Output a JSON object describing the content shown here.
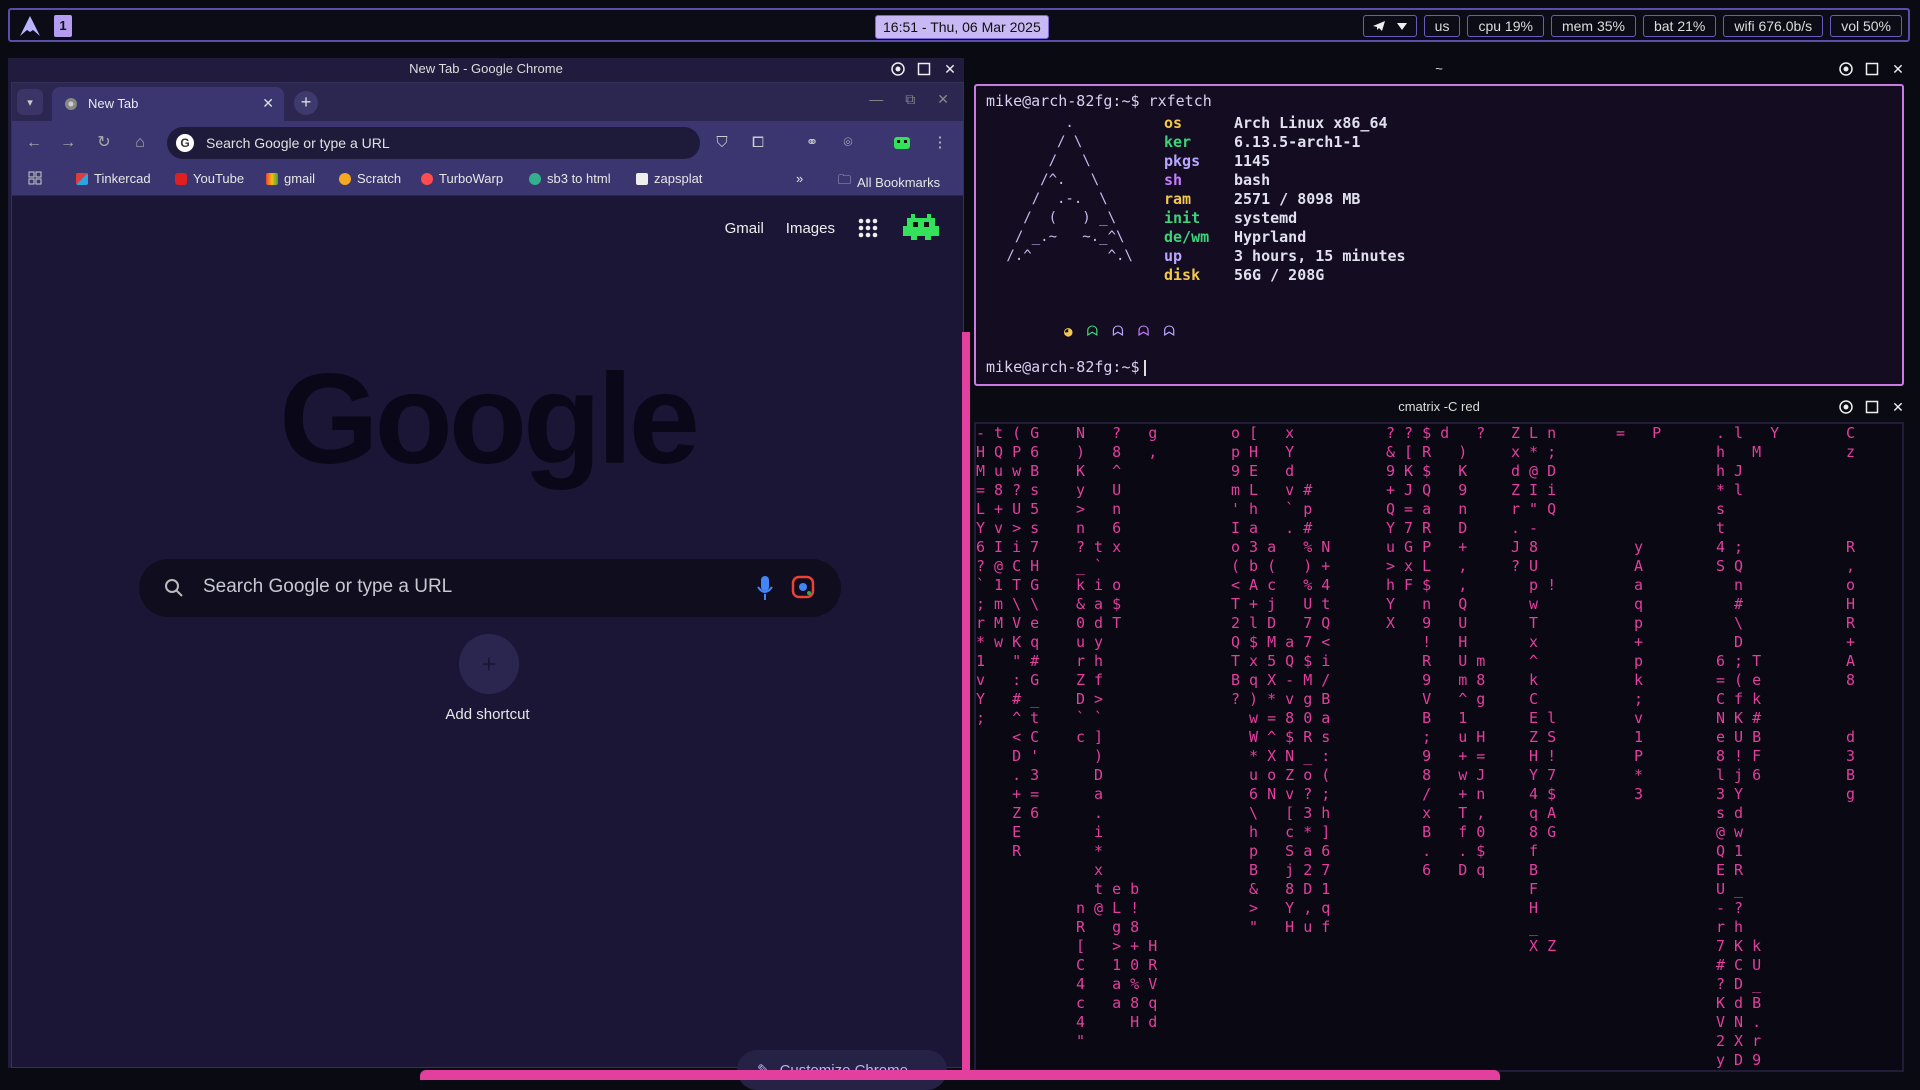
{
  "topbar": {
    "workspace": "1",
    "clock": "16:51 - Thu, 06 Mar 2025",
    "modules": {
      "lang": "us",
      "cpu": "cpu 19%",
      "mem": "mem 35%",
      "bat": "bat 21%",
      "wifi": "wifi 676.0b/s",
      "vol": "vol 50%"
    }
  },
  "chrome": {
    "window_title": "New Tab - Google Chrome",
    "tab_label": "New Tab",
    "omnibox_placeholder": "Search Google or type a URL",
    "bookmarks": [
      "Tinkercad",
      "YouTube",
      "gmail",
      "Scratch",
      "TurboWarp",
      "sb3 to html",
      "zapsplat"
    ],
    "all_bookmarks": "All Bookmarks",
    "ntp": {
      "gmail": "Gmail",
      "images": "Images",
      "logo": "Google",
      "search_placeholder": "Search Google or type a URL",
      "add_shortcut": "Add shortcut",
      "customize": "Customize Chrome"
    }
  },
  "terminal": {
    "window_title": "~",
    "prompt_cmd": "mike@arch-82fg:~$ rxfetch",
    "prompt_idle": "mike@arch-82fg:~$",
    "fetch": [
      {
        "key": "os",
        "value": "Arch Linux x86_64",
        "color": "#f2c94c"
      },
      {
        "key": "ker",
        "value": "6.13.5-arch1-1",
        "color": "#3fd37a"
      },
      {
        "key": "pkgs",
        "value": "1145",
        "color": "#b9a6ff"
      },
      {
        "key": "sh",
        "value": "bash",
        "color": "#c77dff"
      },
      {
        "key": "ram",
        "value": "2571 / 8098 MB",
        "color": "#f2c94c"
      },
      {
        "key": "init",
        "value": "systemd",
        "color": "#3fd37a"
      },
      {
        "key": "de/wm",
        "value": "Hyprland",
        "color": "#3fd37a"
      },
      {
        "key": "up",
        "value": "3 hours, 15 minutes",
        "color": "#b9a6ff"
      },
      {
        "key": "disk",
        "value": "56G / 208G",
        "color": "#f2c94c"
      }
    ],
    "dot_colors": [
      "#f2c94c",
      "#3fd37a",
      "#b9a6ff",
      "#c77dff",
      "#b9a6ff"
    ]
  },
  "matrix": {
    "window_title": "cmatrix -C red",
    "columns": [
      "- t ( G\nH Q P 6\nM u w B\n= 8 ? s\nL + U 5\nY v > s\n6 I i 7\n? @ C H\n` 1 T G\n; m \\ \\\nr M V e\n* w K q\n1   \" #\nv   : G\nY   # _\n;   ^ t\n    < C\n    D '\n    . 3\n    + =\n    Z 6\n    E\n    R",
      "N   ?   g\n)   8   ,\nK   ^\ny   U\n>   n\nn   6\n? t x\n_ `\nk i o\n& a $\n0 d T\nu y\nr h\nZ f\nD >\n` `\nc ]\n  )\n  D\n  a\n  .\n  i\n  *\n  x\n  t e b\nn @ L !\nR   g 8\n[   > + H\nC   1 0 R\n4   a % V\nc   a 8 q\n4     H d\n\"",
      "o [   x\np H   Y\n9 E   d\nm L   v #\n' h   ` p\nI a   . #\no 3 a   % N\n( b (   ) +\n< A c   % 4\nT + j   U t\n2 l D   7 Q\nQ $ M a 7 <\nT x 5 Q $ i\nB q X - M /\n? ) * v g B\n  w = 8 0 a\n  W ^ $ R s\n  * X N _ :\n  u o Z o (\n  6 N v ? ;\n  \\   [ 3 h\n  h   c * ]\n  p   S a 6\n  B   j 2 7\n  &   8 D 1\n  >   Y , q\n  \"   H u f",
      "? ? $ d   ?\n& [ R   )\n9 K $   K\n+ J Q   9\nQ = a   n\nY 7 R   D\nu G P   +\n> x L   ,\nh F $   ,\nY   n   Q\nX   9   U\n    !   H\n    R   U m\n    9   m 8\n    V   ^ g\n    B   1\n    ;   u H\n    9   + =\n    8   w J\n    /   + n\n    x   T ,\n    B   f 0\n    .   . $\n    6   D q",
      "Z L n\nx * ;\nd @ D\nZ I i\nr \" Q\n. -\nJ 8\n? U\n  p !\n  w\n  T\n  x\n  ^\n  k\n  C\n  E l\n  Z S\n  H !\n  Y 7\n  4 $\n  q A\n  8 G\n  f\n  B\n  F\n  H\n  _\n  X Z",
      "=   P\n\n\n\n\n\n  y\n  A\n  a\n  q\n  p\n  +\n  p\n  k\n  ;\n  v\n  1\n  P\n  *\n  3",
      ". l   Y\nh   M\nh J\n* l\ns\nt\n4 ;\nS Q\n  n\n  #\n  \\\n  D\n6 ; T\n= ( e\nC f k\nN K #\ne U B\n8 ! F\nl j 6\n3 Y\ns d\n@ w\nQ 1\nE R\nU _\n- ?\nr h\n7 K k\n# C U\n? D _\nK d B\nV N .\n2 X r\ny D 9",
      "C\nz\n\n\n\n\nR\n,\no\nH\nR\n+\nA\n8\n\n\nd\n3\nB\ng"
    ]
  }
}
